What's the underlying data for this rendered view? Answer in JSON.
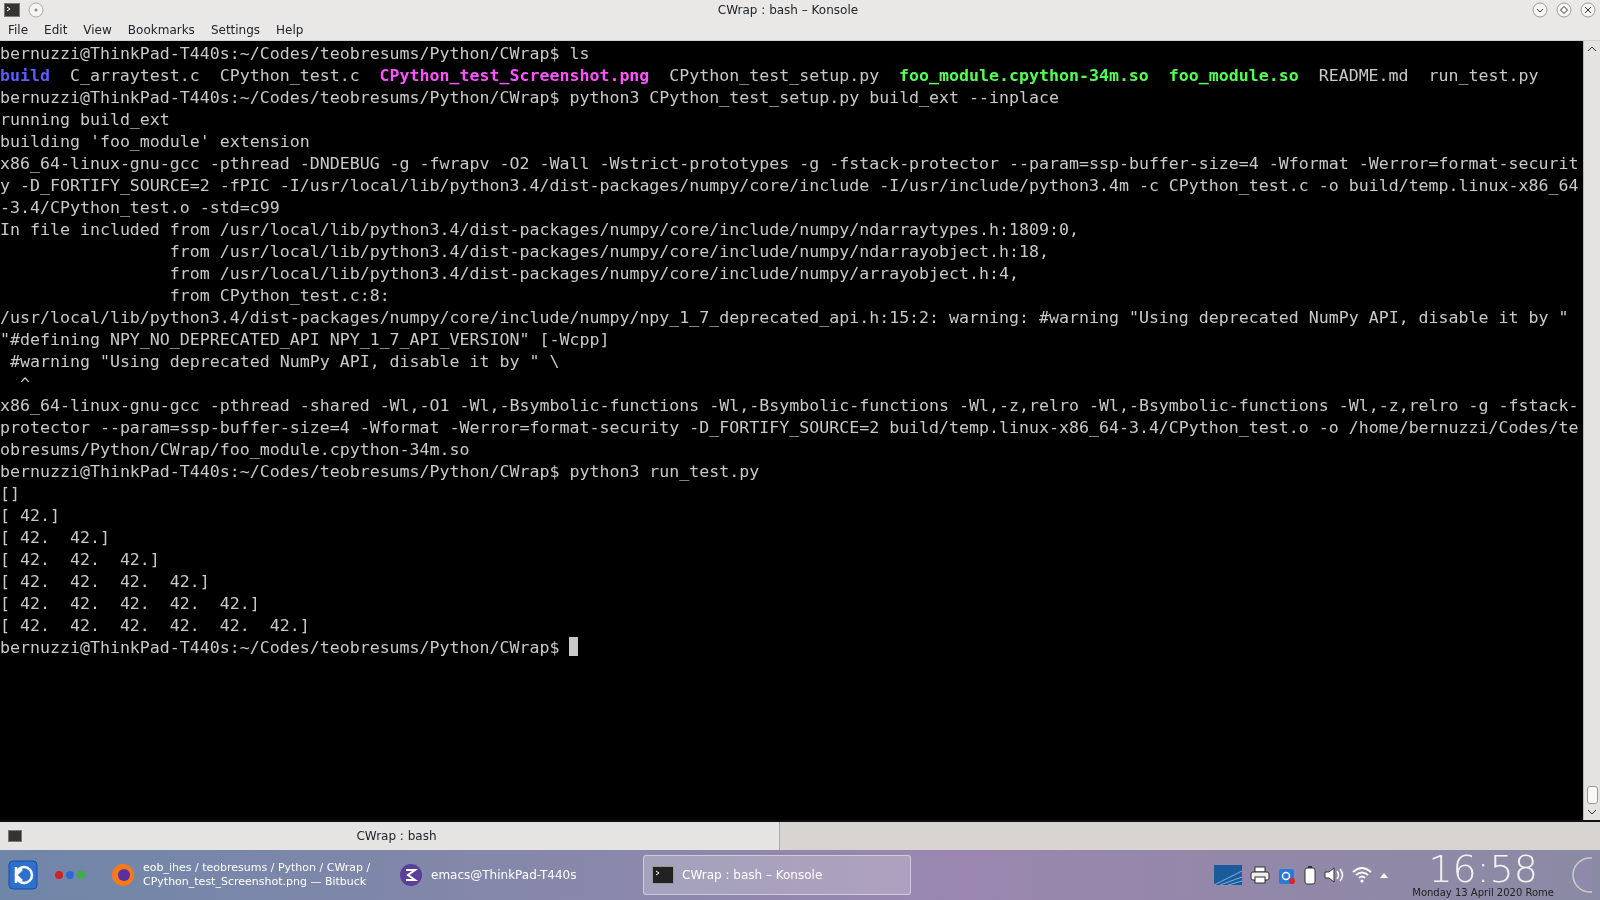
{
  "window": {
    "title": "CWrap : bash – Konsole"
  },
  "menu": [
    "File",
    "Edit",
    "View",
    "Bookmarks",
    "Settings",
    "Help"
  ],
  "terminal": {
    "lines": [
      {
        "text": "bernuzzi@ThinkPad-T440s:~/Codes/teobresums/Python/CWrap$ ls"
      },
      {
        "files": [
          {
            "name": "build",
            "kind": "dir"
          },
          {
            "name": "C_arraytest.c",
            "kind": "file"
          },
          {
            "name": "CPython_test.c",
            "kind": "file"
          },
          {
            "name": "CPython_test_Screenshot.png",
            "kind": "image"
          },
          {
            "name": "CPython_test_setup.py",
            "kind": "file"
          },
          {
            "name": "foo_module.cpython-34m.so",
            "kind": "library"
          },
          {
            "name": "foo_module.so",
            "kind": "library"
          },
          {
            "name": "README.md",
            "kind": "file"
          },
          {
            "name": "run_test.py",
            "kind": "file"
          }
        ]
      },
      {
        "text": "bernuzzi@ThinkPad-T440s:~/Codes/teobresums/Python/CWrap$ python3 CPython_test_setup.py build_ext --inplace"
      },
      {
        "text": "running build_ext"
      },
      {
        "text": "building 'foo_module' extension"
      },
      {
        "text": "x86_64-linux-gnu-gcc -pthread -DNDEBUG -g -fwrapv -O2 -Wall -Wstrict-prototypes -g -fstack-protector --param=ssp-buffer-size=4 -Wformat -Werror=format-securit"
      },
      {
        "text": "y -D_FORTIFY_SOURCE=2 -fPIC -I/usr/local/lib/python3.4/dist-packages/numpy/core/include -I/usr/include/python3.4m -c CPython_test.c -o build/temp.linux-x86_64"
      },
      {
        "text": "-3.4/CPython_test.o -std=c99"
      },
      {
        "text": "In file included from /usr/local/lib/python3.4/dist-packages/numpy/core/include/numpy/ndarraytypes.h:1809:0,"
      },
      {
        "text": "                 from /usr/local/lib/python3.4/dist-packages/numpy/core/include/numpy/ndarrayobject.h:18,"
      },
      {
        "text": "                 from /usr/local/lib/python3.4/dist-packages/numpy/core/include/numpy/arrayobject.h:4,"
      },
      {
        "text": "                 from CPython_test.c:8:"
      },
      {
        "text": "/usr/local/lib/python3.4/dist-packages/numpy/core/include/numpy/npy_1_7_deprecated_api.h:15:2: warning: #warning \"Using deprecated NumPy API, disable it by \""
      },
      {
        "text": "\"#defining NPY_NO_DEPRECATED_API NPY_1_7_API_VERSION\" [-Wcpp]"
      },
      {
        "text": " #warning \"Using deprecated NumPy API, disable it by \" \\"
      },
      {
        "text": "  ^"
      },
      {
        "text": "x86_64-linux-gnu-gcc -pthread -shared -Wl,-O1 -Wl,-Bsymbolic-functions -Wl,-Bsymbolic-functions -Wl,-z,relro -Wl,-Bsymbolic-functions -Wl,-z,relro -g -fstack-"
      },
      {
        "text": "protector --param=ssp-buffer-size=4 -Wformat -Werror=format-security -D_FORTIFY_SOURCE=2 build/temp.linux-x86_64-3.4/CPython_test.o -o /home/bernuzzi/Codes/te"
      },
      {
        "text": "obresums/Python/CWrap/foo_module.cpython-34m.so"
      },
      {
        "text": "bernuzzi@ThinkPad-T440s:~/Codes/teobresums/Python/CWrap$ python3 run_test.py"
      },
      {
        "text": "[]"
      },
      {
        "text": "[ 42.]"
      },
      {
        "text": "[ 42.  42.]"
      },
      {
        "text": "[ 42.  42.  42.]"
      },
      {
        "text": "[ 42.  42.  42.  42.]"
      },
      {
        "text": "[ 42.  42.  42.  42.  42.]"
      },
      {
        "text": "[ 42.  42.  42.  42.  42.  42.]"
      },
      {
        "text": "bernuzzi@ThinkPad-T440s:~/Codes/teobresums/Python/CWrap$ ",
        "cursor": true
      }
    ]
  },
  "tab_bar": {
    "tabs": [
      {
        "label": "CWrap : bash",
        "selected": true
      }
    ]
  },
  "taskbar": {
    "tasks": [
      {
        "kind": "browser",
        "lines": [
          "eob_ihes / teobresums / Python / CWrap /",
          "CPython_test_Screenshot.png — Bitbuck"
        ],
        "selected": false
      },
      {
        "kind": "emacs",
        "lines": [
          "emacs@ThinkPad-T440s"
        ],
        "selected": false
      },
      {
        "kind": "terminal",
        "lines": [
          "CWrap : bash – Konsole"
        ],
        "selected": true
      }
    ],
    "clock": {
      "time": "16:58",
      "date": "Monday 13 April 2020 Rome"
    }
  }
}
